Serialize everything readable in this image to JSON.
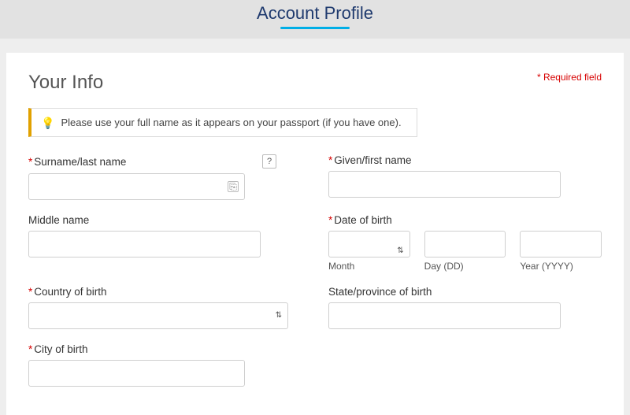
{
  "header": {
    "title": "Account Profile"
  },
  "section": {
    "title": "Your Info",
    "required_note": "* Required field"
  },
  "hint": {
    "text": "Please use your full name as it appears on your passport (if you have one)."
  },
  "labels": {
    "surname": "Surname/last name",
    "given": "Given/first name",
    "middle": "Middle name",
    "dob": "Date of birth",
    "dob_month": "Month",
    "dob_day": "Day (DD)",
    "dob_year": "Year (YYYY)",
    "country": "Country of birth",
    "state": "State/province of birth",
    "city": "City of birth"
  },
  "values": {
    "surname": "",
    "given": "",
    "middle": "",
    "dob_month": "",
    "dob_day": "",
    "dob_year": "",
    "country": "",
    "state": "",
    "city": ""
  },
  "icons": {
    "help": "?",
    "bulb": "💡",
    "autofill": "⎘",
    "caret": "▾",
    "double_caret": "⇅"
  },
  "colors": {
    "brand_text": "#1f3a6e",
    "accent_underline": "#00aee6",
    "required": "#d70000",
    "hint_border": "#e1a100"
  }
}
